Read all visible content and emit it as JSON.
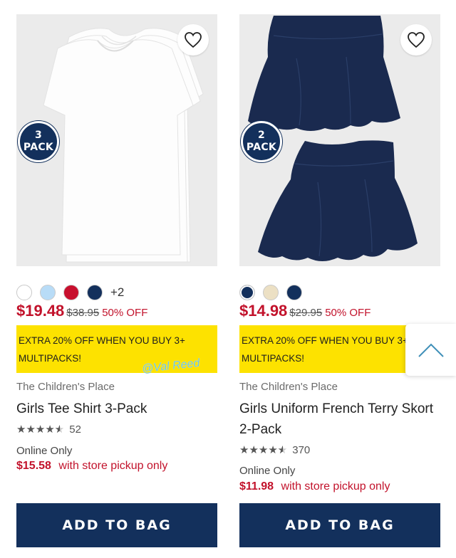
{
  "products": [
    {
      "pack_line1": "3",
      "pack_line2": "PACK",
      "swatches": [
        "#ffffff",
        "#b8dcf7",
        "#c8102e",
        "#13305c"
      ],
      "more_colors": "+2",
      "price": "$19.48",
      "original_price": "$38.95",
      "discount": "50% OFF",
      "promo": "EXTRA 20% OFF WHEN YOU BUY 3+\nMULTIPACKS!",
      "brand": "The Children's Place",
      "title": "Girls Tee Shirt 3-Pack",
      "rating": 4.5,
      "review_count": "52",
      "availability": "Online Only",
      "pickup_price": "$15.58",
      "pickup_text": "with store pickup only",
      "add_label": "ADD TO BAG"
    },
    {
      "pack_line1": "2",
      "pack_line2": "PACK",
      "swatches": [
        "#13305c",
        "#ece0c4",
        "#13305c"
      ],
      "price": "$14.98",
      "original_price": "$29.95",
      "discount": "50% OFF",
      "promo": "EXTRA 20% OFF WHEN YOU BUY 3+\nMULTIPACKS!",
      "brand": "The Children's Place",
      "title": "Girls Uniform French Terry Skort 2-Pack",
      "rating": 4.5,
      "review_count": "370",
      "availability": "Online Only",
      "pickup_price": "$11.98",
      "pickup_text": "with store pickup only",
      "add_label": "ADD TO BAG"
    }
  ],
  "watermark": "@Val Reed",
  "colors": {
    "brand_navy": "#13305c",
    "sale_red": "#c2122b",
    "promo_yellow": "#fde200",
    "image_bg": "#ebebeb"
  },
  "icons": {
    "favorite": "heart-outline-icon",
    "scroll": "chevron-up-icon",
    "rating": "star-icon"
  }
}
